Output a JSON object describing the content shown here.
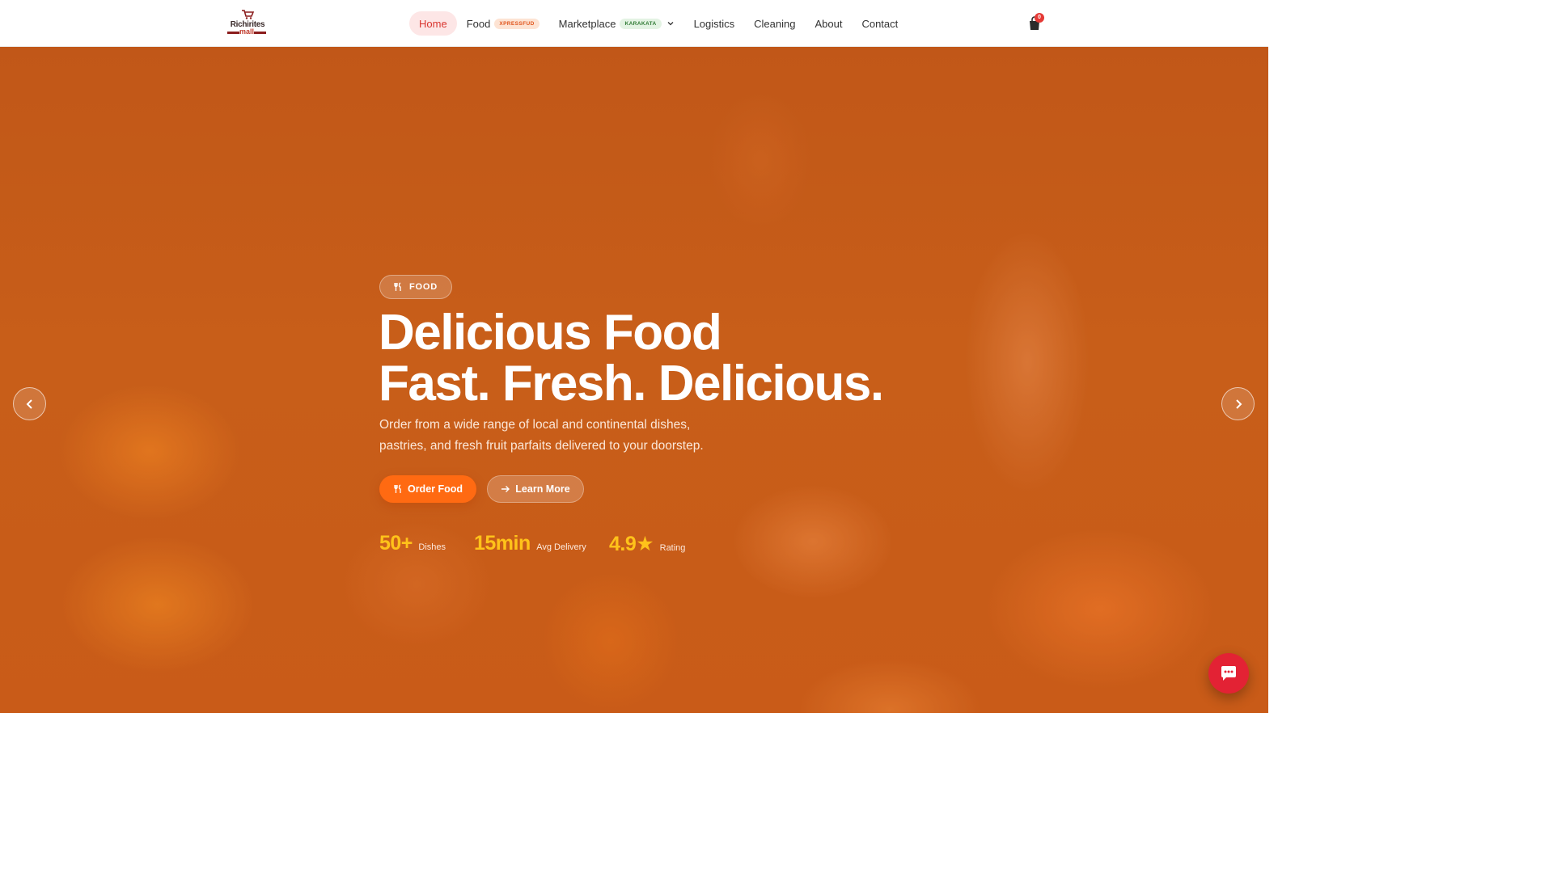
{
  "brand": {
    "line1": "Richirites",
    "line2": "mall"
  },
  "nav": {
    "items": [
      {
        "label": "Home",
        "active": true
      },
      {
        "label": "Food",
        "badge": "XPRESSFUD"
      },
      {
        "label": "Marketplace",
        "badge": "KARAKATA",
        "has_dropdown": true
      },
      {
        "label": "Logistics"
      },
      {
        "label": "Cleaning"
      },
      {
        "label": "About"
      },
      {
        "label": "Contact"
      }
    ]
  },
  "cart": {
    "count": "0",
    "icon": "shopping-bag-icon"
  },
  "hero": {
    "category": "FOOD",
    "headline_line1": "Delicious Food",
    "headline_line2": "Fast. Fresh. Delicious.",
    "subtext": "Order from a wide range of local and continental dishes, pastries, and fresh fruit parfaits delivered to your doorstep.",
    "primary_button": "Order Food",
    "secondary_button": "Learn More",
    "stats": [
      {
        "value": "50+",
        "label": "Dishes"
      },
      {
        "value": "15min",
        "label": "Avg Delivery"
      },
      {
        "value": "4.9★",
        "label": "Rating"
      }
    ]
  },
  "colors": {
    "accent": "#ff6a12",
    "active_nav_text": "#d9352f",
    "stat_value": "#ffc21a",
    "chat_button": "#e32234"
  }
}
